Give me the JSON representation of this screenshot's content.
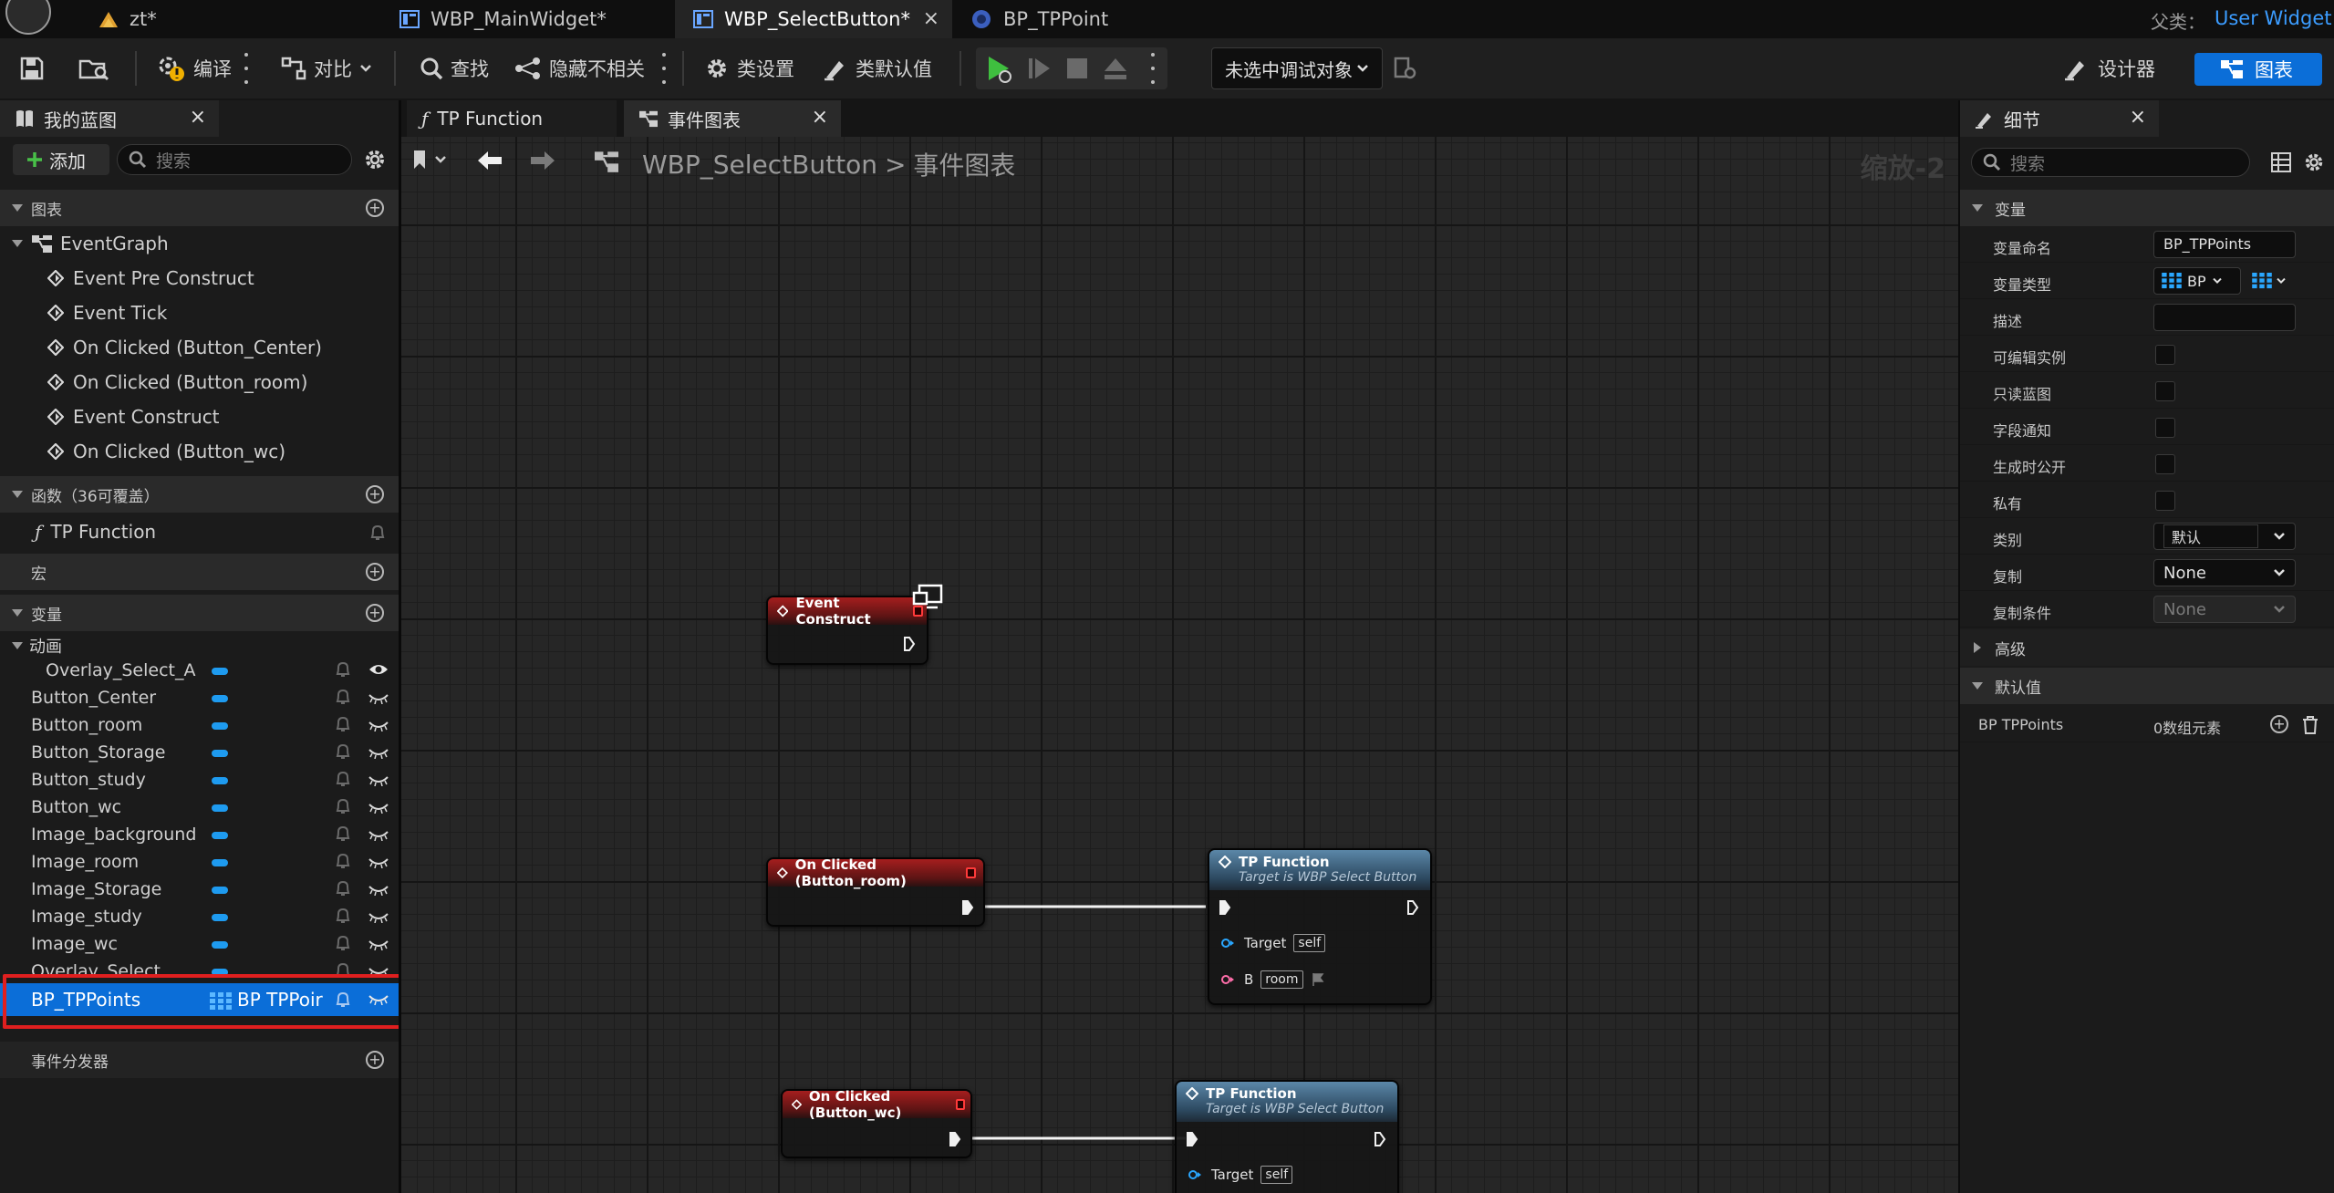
{
  "titlebar": {
    "tabs": [
      {
        "label": "zt*"
      },
      {
        "label": "WBP_MainWidget*"
      },
      {
        "label": "WBP_SelectButton*"
      },
      {
        "label": "BP_TPPoint"
      }
    ],
    "parent_label": "父类：",
    "parent_value": "User Widget"
  },
  "toolbar": {
    "compile": "编译",
    "diff": "对比",
    "find": "查找",
    "hide_unrelated": "隐藏不相关",
    "class_settings": "类设置",
    "class_defaults": "类默认值",
    "debug_target": "未选中调试对象",
    "designer": "设计器",
    "graph": "图表"
  },
  "left_panel": {
    "tab_title": "我的蓝图",
    "add_label": "添加",
    "search_placeholder": "搜索",
    "graphs_header": "图表",
    "event_graph": "EventGraph",
    "events": [
      "Event Pre Construct",
      "Event Tick",
      "On Clicked (Button_Center)",
      "On Clicked (Button_room)",
      "Event Construct",
      "On Clicked (Button_wc)"
    ],
    "functions_header": "函数（36可覆盖）",
    "function_item": "TP Function",
    "macros_header": "宏",
    "variables_header": "变量",
    "anim_category": "动画",
    "anim_var": "Overlay_Select_A",
    "variables": [
      "Button_Center",
      "Button_room",
      "Button_Storage",
      "Button_study",
      "Button_wc",
      "Image_background",
      "Image_room",
      "Image_Storage",
      "Image_study",
      "Image_wc",
      "Overlay_Select"
    ],
    "selected_var": {
      "name": "BP_TPPoints",
      "type": "BP TPPoir"
    },
    "dispatchers_header": "事件分发器",
    "highlight_color": "#e01f1f"
  },
  "graph": {
    "tabs": [
      {
        "label": "TP Function"
      },
      {
        "label": "事件图表"
      }
    ],
    "breadcrumb_root": "WBP_SelectButton",
    "breadcrumb_sep": ">",
    "breadcrumb_leaf": "事件图表",
    "zoom": "缩放-2",
    "nodes": {
      "event_construct": "Event Construct",
      "on_clicked_room": "On Clicked (Button_room)",
      "on_clicked_wc": "On Clicked (Button_wc)",
      "tp_function_1": {
        "title": "TP Function",
        "subtitle": "Target is WBP Select Button",
        "target_label": "Target",
        "target_value": "self",
        "b_label": "B",
        "b_value": "room"
      },
      "tp_function_2": {
        "title": "TP Function",
        "subtitle": "Target is WBP Select Button",
        "target_label": "Target",
        "target_value": "self"
      }
    }
  },
  "details": {
    "tab_title": "细节",
    "search_placeholder": "搜索",
    "variable_header": "变量",
    "props": [
      {
        "label": "变量命名",
        "value": "BP_TPPoints"
      },
      {
        "label": "变量类型",
        "value": "BP"
      },
      {
        "label": "描述",
        "value": ""
      },
      {
        "label": "可编辑实例"
      },
      {
        "label": "只读蓝图"
      },
      {
        "label": "字段通知"
      },
      {
        "label": "生成时公开"
      },
      {
        "label": "私有"
      },
      {
        "label": "类别",
        "value": "默认"
      },
      {
        "label": "复制",
        "value": "None"
      },
      {
        "label": "复制条件",
        "value": "None"
      }
    ],
    "advanced_header": "高级",
    "defaults_header": "默认值",
    "default_row_label": "BP TPPoints",
    "default_row_value": "0数组元素"
  }
}
